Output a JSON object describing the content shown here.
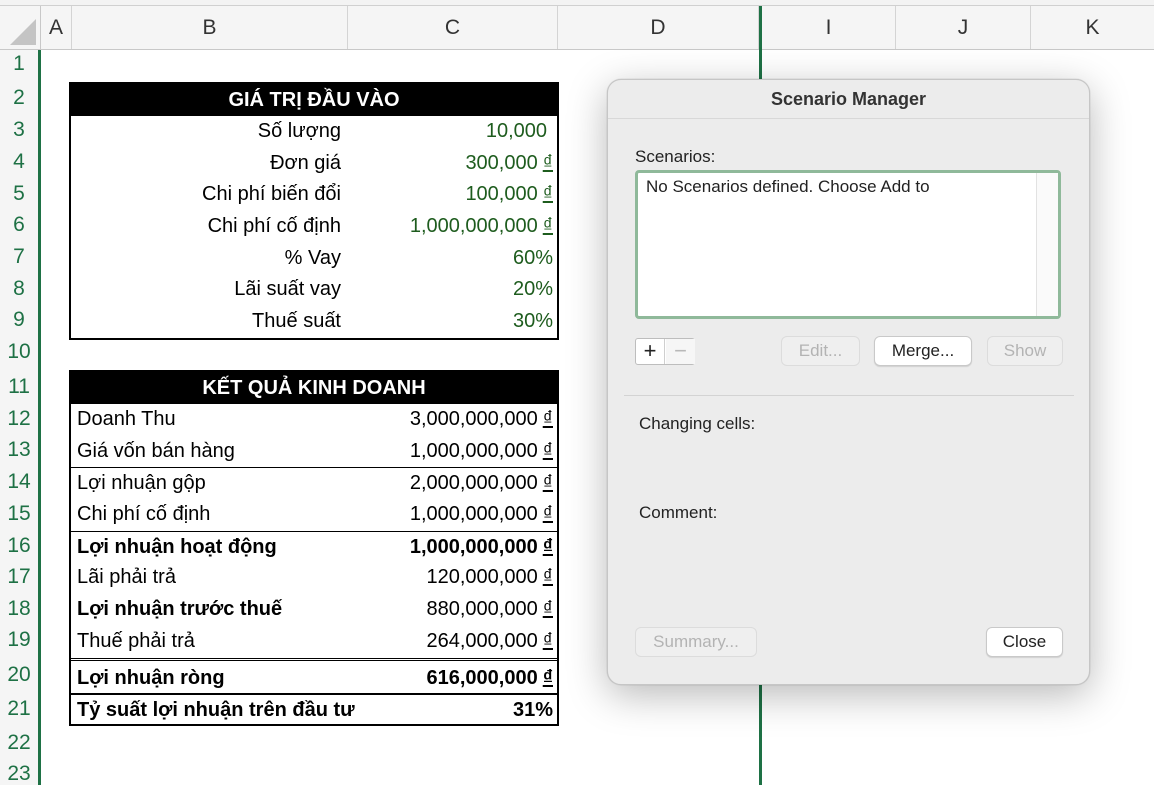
{
  "spreadsheet": {
    "columns": [
      "A",
      "B",
      "C",
      "D",
      "I",
      "J",
      "K"
    ],
    "rows": [
      "1",
      "2",
      "3",
      "4",
      "5",
      "6",
      "7",
      "8",
      "9",
      "10",
      "11",
      "12",
      "13",
      "14",
      "15",
      "16",
      "17",
      "18",
      "19",
      "20",
      "21",
      "22",
      "23"
    ]
  },
  "input_table": {
    "title": "GIÁ TRỊ ĐẦU VÀO",
    "rows": [
      {
        "label": "Số lượng",
        "value": "10,000",
        "currency": ""
      },
      {
        "label": "Đơn giá",
        "value": "300,000",
        "currency": "₫"
      },
      {
        "label": "Chi phí biến đổi",
        "value": "100,000",
        "currency": "₫"
      },
      {
        "label": "Chi phí cố định",
        "value": "1,000,000,000",
        "currency": "₫"
      },
      {
        "label": "% Vay",
        "value": "60%",
        "currency": ""
      },
      {
        "label": "Lãi suất vay",
        "value": "20%",
        "currency": ""
      },
      {
        "label": "Thuế suất",
        "value": "30%",
        "currency": ""
      }
    ]
  },
  "result_table": {
    "title": "KẾT QUẢ KINH DOANH",
    "rows": [
      {
        "label": "Doanh Thu",
        "value": "3,000,000,000",
        "currency": "₫"
      },
      {
        "label": "Giá vốn bán hàng",
        "value": "1,000,000,000",
        "currency": "₫"
      },
      {
        "label": "Lợi nhuận gộp",
        "value": "2,000,000,000",
        "currency": "₫"
      },
      {
        "label": "Chi phí cố định",
        "value": "1,000,000,000",
        "currency": "₫"
      },
      {
        "label": "Lợi nhuận hoạt động",
        "value": "1,000,000,000",
        "currency": "₫"
      },
      {
        "label": "Lãi phải trả",
        "value": "120,000,000",
        "currency": "₫"
      },
      {
        "label": "Lợi nhuận trước thuế",
        "value": "880,000,000",
        "currency": "₫"
      },
      {
        "label": "Thuế phải trả",
        "value": "264,000,000",
        "currency": "₫"
      },
      {
        "label": "Lợi nhuận ròng",
        "value": "616,000,000",
        "currency": "₫"
      },
      {
        "label": "Tỷ suất lợi nhuận trên đầu tư",
        "value": "31%",
        "currency": ""
      }
    ]
  },
  "dialog": {
    "title": "Scenario Manager",
    "scenarios_label": "Scenarios:",
    "scenarios_empty_text": "No Scenarios defined. Choose Add to",
    "add_symbol": "+",
    "remove_symbol": "−",
    "edit_label": "Edit...",
    "merge_label": "Merge...",
    "show_label": "Show",
    "changing_cells_label": "Changing cells:",
    "comment_label": "Comment:",
    "summary_label": "Summary...",
    "close_label": "Close"
  },
  "colors": {
    "accent_green": "#1e7145",
    "input_value_green": "#1e5c1e",
    "focus_ring": "#8fb99a"
  }
}
